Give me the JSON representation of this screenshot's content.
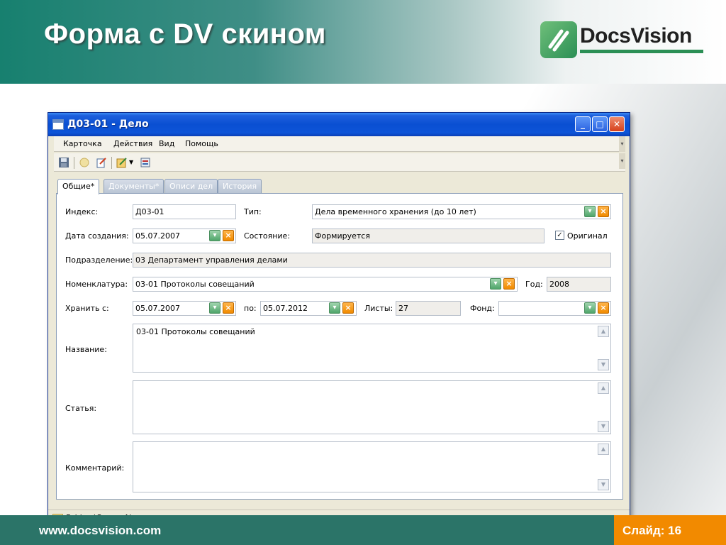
{
  "slide": {
    "title": "Форма с DV скином",
    "logo_text": "DocsVision",
    "footer_url": "www.docsvision.com",
    "slide_number": "Слайд: 16",
    "colors": {
      "header_teal": "#17806f",
      "footer_teal": "#2b7468",
      "accent_orange": "#f28a00"
    }
  },
  "window": {
    "title": "Д03-01 - Дело",
    "controls": {
      "minimize": "_",
      "maximize": "□",
      "close": "✕"
    }
  },
  "menu": [
    "Карточка",
    "Действия",
    "Вид",
    "Помощь"
  ],
  "toolbar": {
    "icons": [
      "save-icon",
      "attach-icon",
      "edit-icon",
      "action-icon",
      "dropdown-arrow-icon",
      "properties-icon"
    ]
  },
  "tabs": [
    {
      "label": "Общие*",
      "active": true
    },
    {
      "label": "Документы*",
      "active": false
    },
    {
      "label": "Описи дел",
      "active": false
    },
    {
      "label": "История",
      "active": false
    }
  ],
  "form": {
    "index": {
      "label": "Индекс:",
      "value": "Д03-01"
    },
    "type": {
      "label": "Тип:",
      "value": "Дела временного хранения (до 10 лет)"
    },
    "created": {
      "label": "Дата создания:",
      "value": "05.07.2007"
    },
    "state": {
      "label": "Состояние:",
      "value": "Формируется"
    },
    "original": {
      "label": "Оригинал",
      "checked": true
    },
    "department": {
      "label": "Подразделение:",
      "value": "03 Департамент управления делами"
    },
    "nomenclature": {
      "label": "Номенклатура:",
      "value": "03-01 Протоколы совещаний"
    },
    "year": {
      "label": "Год:",
      "value": "2008"
    },
    "store_from": {
      "label": "Хранить с:",
      "value": "05.07.2007"
    },
    "store_to": {
      "label": "по:",
      "value": "05.07.2012"
    },
    "sheets": {
      "label": "Листы:",
      "value": "27"
    },
    "fund": {
      "label": "Фонд:",
      "value": ""
    },
    "name": {
      "label": "Название:",
      "value": "03-01 Протоколы совещаний"
    },
    "article": {
      "label": "Статья:",
      "value": ""
    },
    "comment": {
      "label": "Комментарий:",
      "value": ""
    }
  },
  "status": {
    "path": "Folders\\SergeyAl"
  }
}
